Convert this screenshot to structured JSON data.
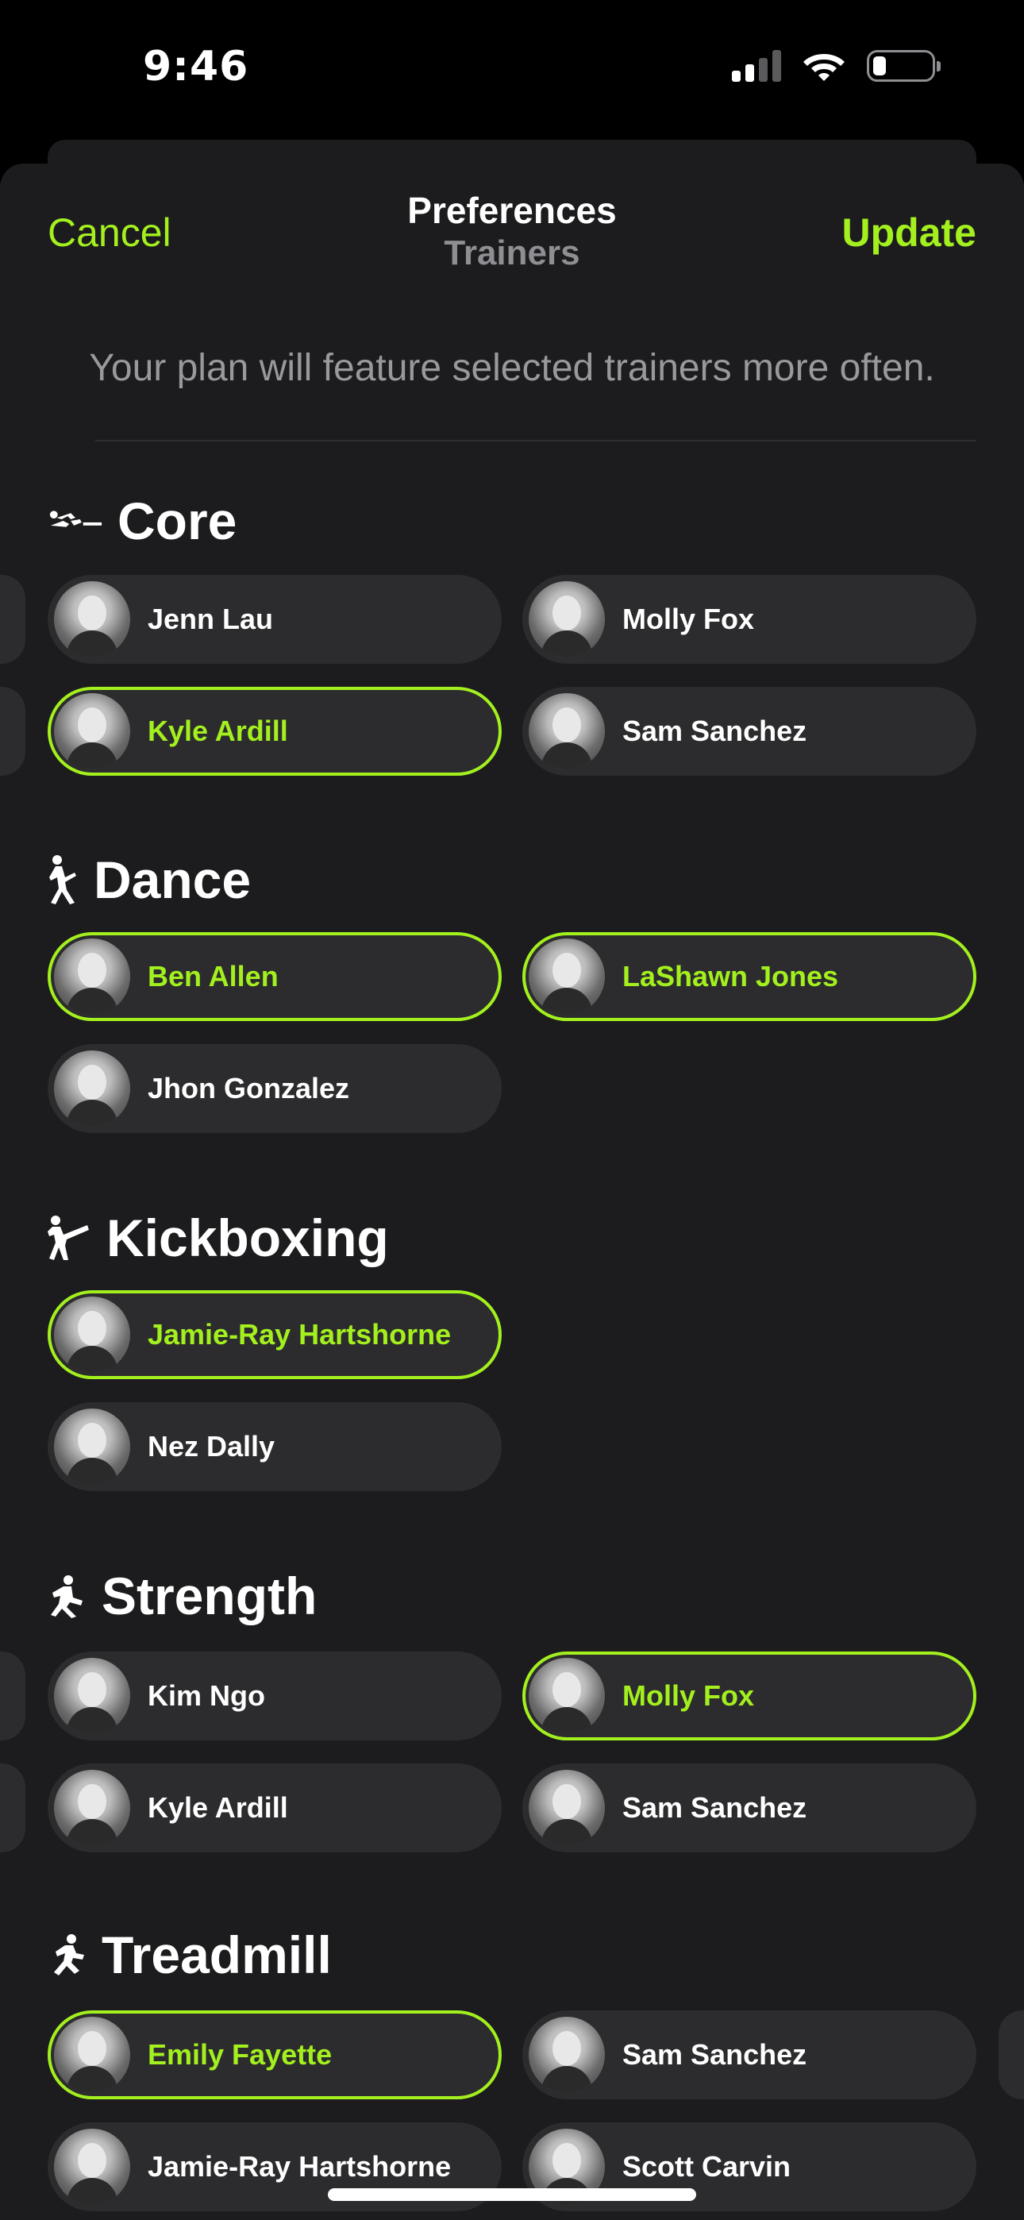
{
  "status_bar": {
    "time": "9:46"
  },
  "nav": {
    "cancel_label": "Cancel",
    "update_label": "Update",
    "title": "Preferences",
    "subtitle": "Trainers"
  },
  "intro_text": "Your plan will feature selected trainers more often.",
  "colors": {
    "accent": "#a3f01e",
    "background": "#1c1c1e",
    "chip": "#2c2c2e",
    "secondary_text": "#8e8e93"
  },
  "sections": [
    {
      "title": "Core",
      "icon": "core-icon",
      "trainers": [
        {
          "name": "Jenn Lau",
          "selected": false
        },
        {
          "name": "Molly Fox",
          "selected": false
        },
        {
          "name": "Kyle Ardill",
          "selected": true
        },
        {
          "name": "Sam Sanchez",
          "selected": false
        }
      ]
    },
    {
      "title": "Dance",
      "icon": "dance-icon",
      "trainers": [
        {
          "name": "Ben Allen",
          "selected": true
        },
        {
          "name": "LaShawn Jones",
          "selected": true
        },
        {
          "name": "Jhon Gonzalez",
          "selected": false
        }
      ]
    },
    {
      "title": "Kickboxing",
      "icon": "kickboxing-icon",
      "trainers": [
        {
          "name": "Jamie-Ray Hartshorne",
          "selected": true
        },
        {
          "name": "Nez Dally",
          "selected": false
        }
      ]
    },
    {
      "title": "Strength",
      "icon": "strength-icon",
      "trainers": [
        {
          "name": "Kim Ngo",
          "selected": false
        },
        {
          "name": "Molly Fox",
          "selected": true
        },
        {
          "name": "Kyle Ardill",
          "selected": false
        },
        {
          "name": "Sam Sanchez",
          "selected": false
        }
      ]
    },
    {
      "title": "Treadmill",
      "icon": "treadmill-icon",
      "trainers": [
        {
          "name": "Emily Fayette",
          "selected": true
        },
        {
          "name": "Sam Sanchez",
          "selected": false
        },
        {
          "name": "Jamie-Ray Hartshorne",
          "selected": false
        },
        {
          "name": "Scott Carvin",
          "selected": false
        }
      ]
    }
  ]
}
